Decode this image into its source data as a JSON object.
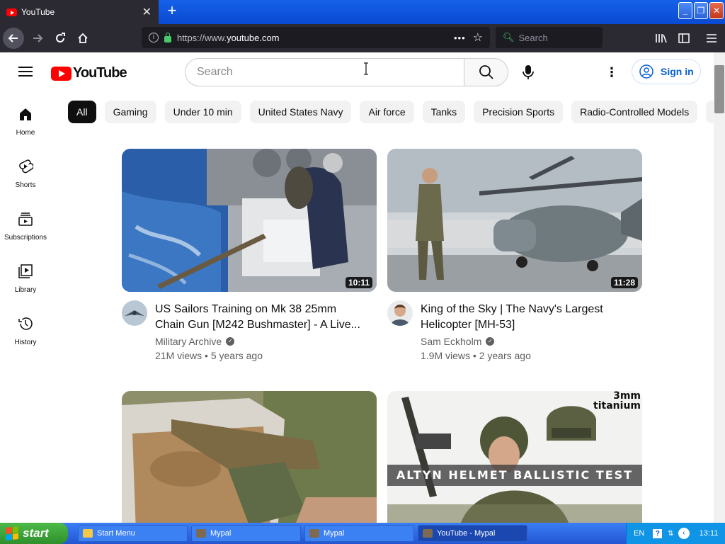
{
  "browser": {
    "tab_title": "YouTube",
    "tab_close": "✕",
    "new_tab": "+",
    "url_prefix": "https://www.",
    "url_domain": "youtube.com",
    "url_menu": "•••",
    "search_placeholder": "Search",
    "win_minimize": "_",
    "win_restore": "❐",
    "win_close": "✕"
  },
  "header": {
    "logo_text": "YouTube",
    "search_placeholder": "Search",
    "more_icon": "⋮",
    "signin_label": "Sign in"
  },
  "sidebar": {
    "items": [
      {
        "label": "Home"
      },
      {
        "label": "Shorts"
      },
      {
        "label": "Subscriptions"
      },
      {
        "label": "Library"
      },
      {
        "label": "History"
      }
    ]
  },
  "chips": [
    "All",
    "Gaming",
    "Under 10 min",
    "United States Navy",
    "Air force",
    "Tanks",
    "Precision Sports",
    "Radio-Controlled Models",
    "M"
  ],
  "videos": [
    {
      "title": "US Sailors Training on Mk 38 25mm Chain Gun [M242 Bushmaster] - A Live...",
      "channel": "Military Archive",
      "verified": "✓",
      "views": "21M views",
      "age": "5 years ago",
      "duration": "10:11"
    },
    {
      "title": "King of the Sky | The Navy's Largest Helicopter [MH-53]",
      "channel": "Sam Eckholm",
      "verified": "✓",
      "views": "1.9M views",
      "age": "2 years ago",
      "duration": "11:28"
    },
    {
      "title": "",
      "channel": "",
      "views": "",
      "age": "",
      "duration": ""
    },
    {
      "title": "",
      "channel": "",
      "views": "",
      "age": "",
      "duration": "",
      "overlay_text": "ALTYN HELMET BALLISTIC TEST",
      "corner_text_1": "3mm",
      "corner_text_2": "titanium"
    }
  ],
  "meta_separator": "•",
  "taskbar": {
    "start_label": "start",
    "tasks": [
      "Start Menu",
      "Mypal",
      "Mypal",
      "YouTube - Mypal"
    ],
    "lang": "EN",
    "help": "?",
    "clock": "13:11"
  },
  "colors": {
    "yt_red": "#ff0000",
    "link_blue": "#065fd4",
    "browser_dark": "#2b2a33",
    "xp_blue": "#2456d2",
    "xp_green": "#2f8f2c"
  }
}
